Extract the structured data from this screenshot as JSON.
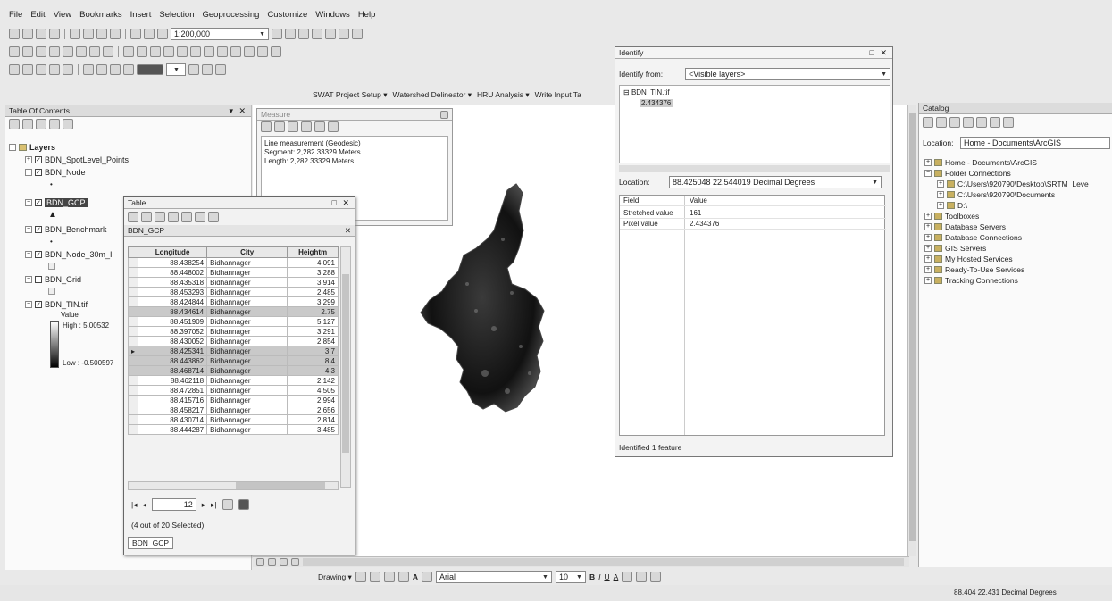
{
  "menu": [
    "File",
    "Edit",
    "View",
    "Bookmarks",
    "Insert",
    "Selection",
    "Geoprocessing",
    "Customize",
    "Windows",
    "Help"
  ],
  "toolbar": {
    "scale": "1:200,000",
    "swat": [
      "SWAT Project Setup ▾",
      "Watershed Delineator ▾",
      "HRU Analysis ▾",
      "Write Input Ta"
    ]
  },
  "toc": {
    "title": "Table Of Contents",
    "root": "Layers",
    "layers": [
      "BDN_SpotLevel_Points",
      "BDN_Node",
      "BDN_GCP",
      "BDN_Benchmark",
      "BDN_Node_30m_I",
      "BDN_Grid",
      "BDN_TIN.tif"
    ],
    "legend_value": "Value",
    "legend_high": "High : 5.00532",
    "legend_low": "Low : -0.500597"
  },
  "table_window": {
    "title": "Table",
    "layer_tab": "BDN_GCP",
    "columns": [
      "Longitude",
      "City",
      "Heightm"
    ],
    "rows": [
      [
        "88.438254",
        "Bidhannager",
        "4.091"
      ],
      [
        "88.448002",
        "Bidhannager",
        "3.288"
      ],
      [
        "88.435318",
        "Bidhannager",
        "3.914"
      ],
      [
        "88.453293",
        "Bidhannager",
        "2.485"
      ],
      [
        "88.424844",
        "Bidhannager",
        "3.299"
      ],
      [
        "88.434614",
        "Bidhannager",
        "2.75"
      ],
      [
        "88.451909",
        "Bidhannager",
        "5.127"
      ],
      [
        "88.397052",
        "Bidhannager",
        "3.291"
      ],
      [
        "88.430052",
        "Bidhannager",
        "2.854"
      ],
      [
        "88.425341",
        "Bidhannager",
        "3.7"
      ],
      [
        "88.443862",
        "Bidhannager",
        "8.4"
      ],
      [
        "88.468714",
        "Bidhannager",
        "4.3"
      ],
      [
        "88.462118",
        "Bidhannager",
        "2.142"
      ],
      [
        "88.472851",
        "Bidhannager",
        "4.505"
      ],
      [
        "88.415716",
        "Bidhannager",
        "2.994"
      ],
      [
        "88.458217",
        "Bidhannager",
        "2.656"
      ],
      [
        "88.430714",
        "Bidhannager",
        "2.814"
      ],
      [
        "88.444287",
        "Bidhannager",
        "3.485"
      ]
    ],
    "selected_rows": [
      5,
      9,
      10,
      11
    ],
    "record_number": "12",
    "selection_status": "(4 out of 20 Selected)",
    "bottom_tab": "BDN_GCP"
  },
  "measure": {
    "title": "Measure",
    "line1": "Line measurement (Geodesic)",
    "line2": "Segment: 2,282.33329 Meters",
    "line3": "Length: 2,282.33329 Meters"
  },
  "identify": {
    "title": "Identify",
    "from_label": "Identify from:",
    "from_value": "<Visible layers>",
    "tree_layer": "BDN_TIN.tif",
    "tree_value": "2.434376",
    "location_label": "Location:",
    "location_value": "88.425048  22.544019 Decimal Degrees",
    "grid_headers": [
      "Field",
      "Value"
    ],
    "grid_rows": [
      [
        "Stretched value",
        "161"
      ],
      [
        "Pixel value",
        "2.434376"
      ]
    ],
    "status": "Identified 1 feature"
  },
  "catalog": {
    "title": "Catalog",
    "location_label": "Location:",
    "location_value": "Home - Documents\\ArcGIS",
    "items": [
      "Home - Documents\\ArcGIS",
      "Folder Connections",
      "C:\\Users\\920790\\Desktop\\SRTM_Leve",
      "C:\\Users\\920790\\Documents",
      "D:\\",
      "Toolboxes",
      "Database Servers",
      "Database Connections",
      "GIS Servers",
      "My Hosted Services",
      "Ready-To-Use Services",
      "Tracking Connections"
    ]
  },
  "drawing_toolbar": {
    "drawing": "Drawing ▾",
    "font": "Arial",
    "size": "10"
  },
  "status": {
    "coords": "88.404  22.431 Decimal Degrees"
  }
}
